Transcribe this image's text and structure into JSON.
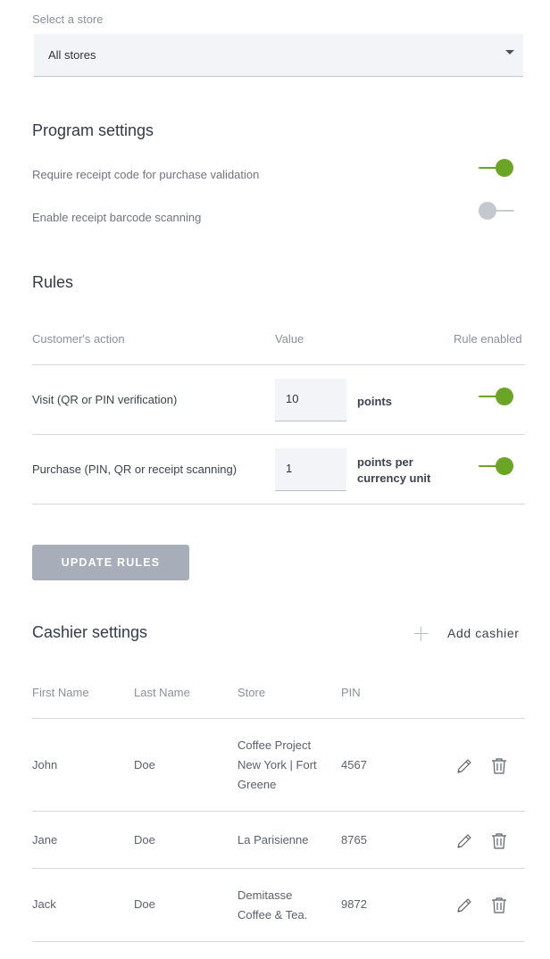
{
  "store_select": {
    "label": "Select a store",
    "value": "All stores"
  },
  "program_settings": {
    "title": "Program settings",
    "settings": [
      {
        "label": "Require receipt code for purchase validation",
        "enabled": true
      },
      {
        "label": "Enable receipt barcode scanning",
        "enabled": false
      }
    ]
  },
  "rules": {
    "title": "Rules",
    "columns": [
      "Customer's action",
      "Value",
      "Rule enabled"
    ],
    "rows": [
      {
        "action": "Visit (QR or PIN verification)",
        "value": "10",
        "unit": "points",
        "enabled": true
      },
      {
        "action": "Purchase (PIN, QR or receipt scanning)",
        "value": "1",
        "unit_line1": "points per",
        "unit_line2": "currency unit",
        "enabled": true
      }
    ],
    "update_button": "UPDATE RULES"
  },
  "cashier_settings": {
    "title": "Cashier settings",
    "add_button": "Add cashier",
    "columns": [
      "First Name",
      "Last Name",
      "Store",
      "PIN"
    ],
    "rows": [
      {
        "first_name": "John",
        "last_name": "Doe",
        "store_lines": [
          "Coffee Project",
          "New York | Fort",
          "Greene"
        ],
        "pin": "4567"
      },
      {
        "first_name": "Jane",
        "last_name": "Doe",
        "store_lines": [
          "La Parisienne"
        ],
        "pin": "8765"
      },
      {
        "first_name": "Jack",
        "last_name": "Doe",
        "store_lines": [
          "Demitasse",
          "Coffee & Tea."
        ],
        "pin": "9872"
      }
    ]
  },
  "colors": {
    "toggle_on": "#6aa526",
    "toggle_off": "#c4c7ce",
    "button_disabled": "#a8aeb9"
  }
}
